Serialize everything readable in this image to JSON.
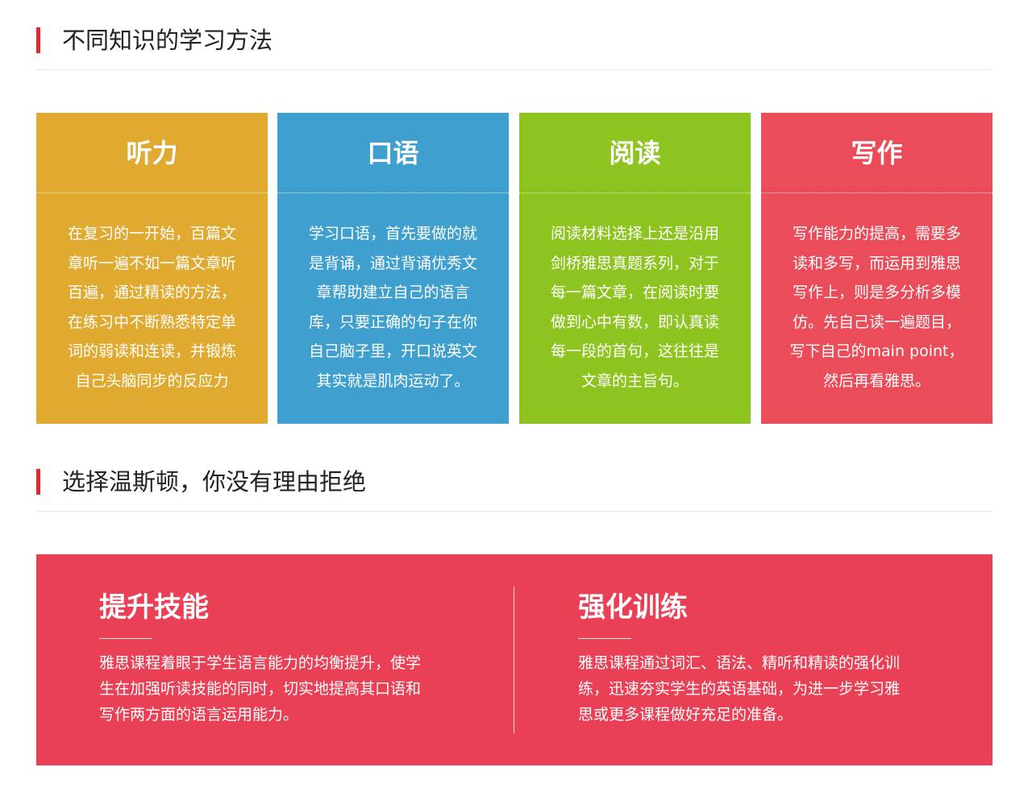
{
  "sections": {
    "methods_title": "不同知识的学习方法",
    "choose_title": "选择温斯顿，你没有理由拒绝"
  },
  "cards": [
    {
      "title": "听力",
      "color": "#e0a92f",
      "lines": [
        "在复习的一开始，百篇文",
        "章听一遍不如一篇文章听",
        "百遍，通过精读的方法，",
        "在练习中不断熟悉特定单",
        "词的弱读和连读，并锻炼",
        "自己头脑同步的反应力"
      ]
    },
    {
      "title": "口语",
      "color": "#3f9fcf",
      "lines": [
        "学习口语，首先要做的就",
        "是背诵，通过背诵优秀文",
        "章帮助建立自己的语言",
        "库，只要正确的句子在你",
        "自己脑子里，开口说英文",
        "其实就是肌肉运动了。"
      ]
    },
    {
      "title": "阅读",
      "color": "#8dc41f",
      "lines": [
        "阅读材料选择上还是沿用",
        "剑桥雅思真题系列，对于",
        "每一篇文章，在阅读时要",
        "做到心中有数，即认真读",
        "每一段的首句，这往往是",
        "文章的主旨句。"
      ]
    },
    {
      "title": "写作",
      "color": "#ea4c5a",
      "lines": [
        "写作能力的提高，需要多",
        "读和多写，而运用到雅思",
        "写作上，则是多分析多模",
        "仿。先自己读一遍题目，",
        "写下自己的main point，",
        "然后再看雅思。"
      ]
    }
  ],
  "panel": {
    "color": "#ea4055",
    "features": [
      {
        "title": "提升技能",
        "lines": [
          "雅思课程着眼于学生语言能力的均衡提升，使学",
          "生在加强听读技能的同时，切实地提高其口语和",
          "写作两方面的语言运用能力。"
        ]
      },
      {
        "title": "强化训练",
        "lines": [
          "雅思课程通过词汇、语法、精听和精读的强化训",
          "练，迅速夯实学生的英语基础，为进一步学习雅",
          "思或更多课程做好充足的准备。"
        ]
      }
    ]
  }
}
